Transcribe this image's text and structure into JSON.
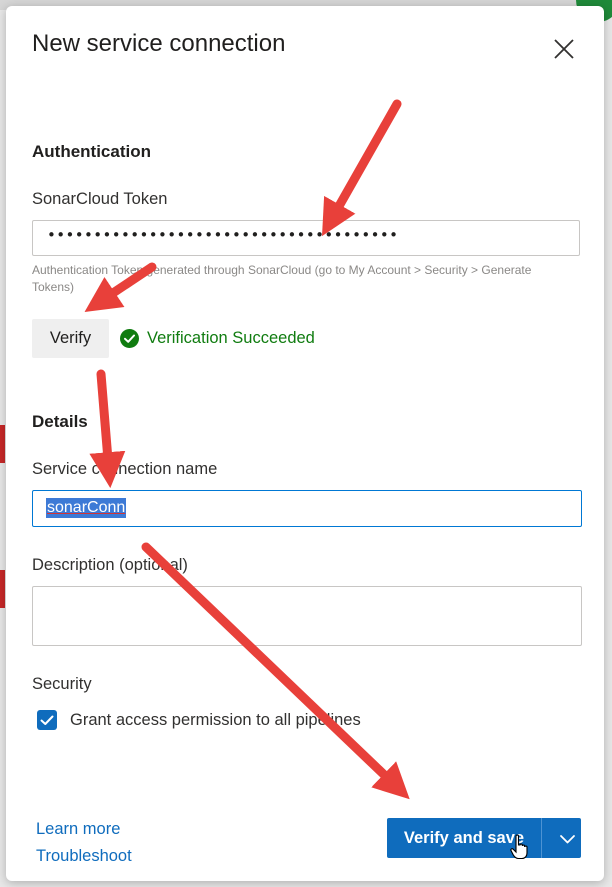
{
  "dialog": {
    "title": "New service connection",
    "close_icon": "close-icon"
  },
  "authentication": {
    "heading": "Authentication",
    "token_label": "SonarCloud Token",
    "token_value": "••••••••••••••••••••••••••••••••••••••",
    "token_helper": "Authentication Token generated through SonarCloud (go to My Account > Security > Generate Tokens)",
    "verify_label": "Verify",
    "status_icon": "check-circle-icon",
    "status_text": "Verification Succeeded"
  },
  "details": {
    "heading": "Details",
    "name_label": "Service connection name",
    "name_value": "sonarConn",
    "description_label": "Description (optional)",
    "description_value": ""
  },
  "security": {
    "heading": "Security",
    "grant_access_label": "Grant access permission to all pipelines",
    "grant_access_checked": true
  },
  "footer": {
    "learn_more": "Learn more",
    "troubleshoot": "Troubleshoot",
    "primary_label": "Verify and save",
    "dropdown_icon": "chevron-down-icon"
  },
  "colors": {
    "primary": "#0f6cbd",
    "success": "#107c10",
    "annotation_arrow": "#e8403a"
  }
}
